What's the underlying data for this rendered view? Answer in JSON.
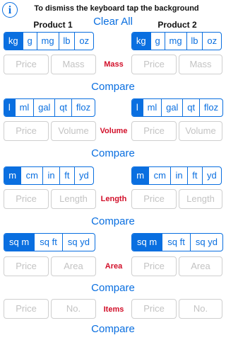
{
  "header": {
    "info_glyph": "i",
    "hint": "To dismiss the keyboard tap the background",
    "product1": "Product 1",
    "product2": "Product 2",
    "clear_all": "Clear All"
  },
  "mass": {
    "label": "Mass",
    "units": [
      "kg",
      "g",
      "mg",
      "lb",
      "oz"
    ],
    "selected_p1": "kg",
    "selected_p2": "kg",
    "price_placeholder": "Price",
    "qty_placeholder": "Mass",
    "compare": "Compare"
  },
  "volume": {
    "label": "Volume",
    "units": [
      "l",
      "ml",
      "gal",
      "qt",
      "floz"
    ],
    "selected_p1": "l",
    "selected_p2": "l",
    "price_placeholder": "Price",
    "qty_placeholder": "Volume",
    "compare": "Compare"
  },
  "length": {
    "label": "Length",
    "units": [
      "m",
      "cm",
      "in",
      "ft",
      "yd"
    ],
    "selected_p1": "m",
    "selected_p2": "m",
    "price_placeholder": "Price",
    "qty_placeholder": "Length",
    "compare": "Compare"
  },
  "area": {
    "label": "Area",
    "units": [
      "sq m",
      "sq ft",
      "sq yd"
    ],
    "selected_p1": "sq m",
    "selected_p2": "sq m",
    "price_placeholder": "Price",
    "qty_placeholder": "Area",
    "compare": "Compare"
  },
  "items": {
    "label": "Items",
    "price_placeholder": "Price",
    "qty_placeholder": "No.",
    "compare": "Compare"
  },
  "colors": {
    "accent": "#0a6fe0",
    "category": "#d2102a",
    "placeholder": "#c3c3c3"
  }
}
